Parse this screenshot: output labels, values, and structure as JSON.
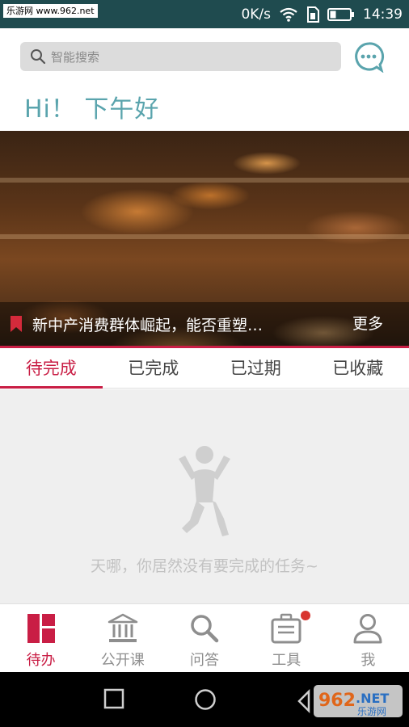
{
  "status_bar": {
    "watermark": "乐游网 www.962.net",
    "network_speed": "0K/s",
    "time": "14:39"
  },
  "search": {
    "placeholder": "智能搜索"
  },
  "greeting": "Hi！ 下午好",
  "banner": {
    "title": "新中产消费群体崛起，能否重塑…",
    "more_label": "更多"
  },
  "tabs": [
    {
      "label": "待完成",
      "active": true
    },
    {
      "label": "已完成",
      "active": false
    },
    {
      "label": "已过期",
      "active": false
    },
    {
      "label": "已收藏",
      "active": false
    }
  ],
  "empty_state": {
    "message": "天哪，你居然没有要完成的任务~"
  },
  "bottom_nav": [
    {
      "label": "待办",
      "icon": "todo-icon",
      "active": true
    },
    {
      "label": "公开课",
      "icon": "institution-icon",
      "active": false
    },
    {
      "label": "问答",
      "icon": "search-icon",
      "active": false
    },
    {
      "label": "工具",
      "icon": "toolbox-icon",
      "active": false,
      "badge": true
    },
    {
      "label": "我",
      "icon": "person-icon",
      "active": false
    }
  ],
  "watermark_bottom": {
    "number": "962",
    "suffix": ".NET",
    "name": "乐游网"
  },
  "colors": {
    "accent": "#c91e45",
    "teal": "#5aa4ad",
    "status_bar": "#1f4b4f"
  }
}
